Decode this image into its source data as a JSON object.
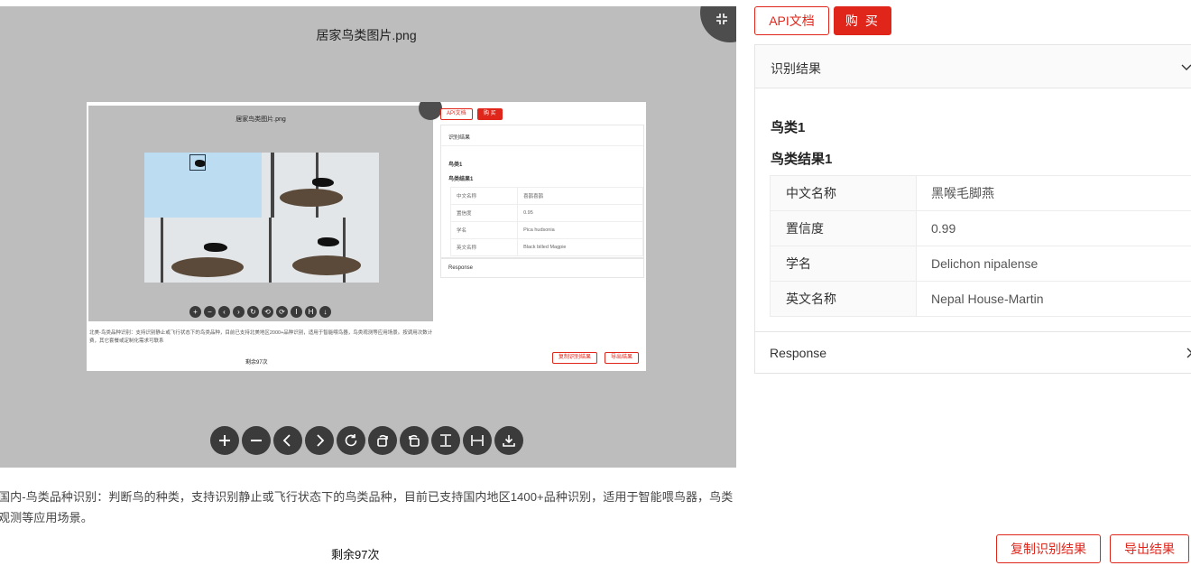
{
  "viewer": {
    "title": "居家鸟类图片.png",
    "toolbar": [
      "zoom-in",
      "zoom-out",
      "previous",
      "next",
      "reset",
      "rotate-left",
      "rotate-right",
      "fit-height",
      "fit-width",
      "download"
    ]
  },
  "embedded_screenshot": {
    "title": "居家鸟类图片.png",
    "api_label": "API文档",
    "buy_label": "购 买",
    "panel_header": "识别结果",
    "bird_title": "鸟类1",
    "result_title": "鸟类结果1",
    "rows": [
      {
        "key": "中文名称",
        "value": "喜鹊喜鹊"
      },
      {
        "key": "置信度",
        "value": "0.95"
      },
      {
        "key": "学名",
        "value": "Pica hudsonia"
      },
      {
        "key": "英文名称",
        "value": "Black billed Magpie"
      }
    ],
    "response_label": "Response",
    "description": "北美-鸟类品种识别：支持识别静止或飞行状态下的鸟类品种，目前已支持北美地区2000+品种识别，适用于智能喂鸟器，鸟类观测等应用场景。按调用次数计费，其它套餐或定制化需求可联系",
    "remaining": "剩余97次",
    "copy_label": "复制识别结果",
    "export_label": "导出结果"
  },
  "description": "国内-鸟类品种识别：判断鸟的种类，支持识别静止或飞行状态下的鸟类品种，目前已支持国内地区1400+品种识别，适用于智能喂鸟器，鸟类观测等应用场景。",
  "remaining": "剩余97次",
  "header": {
    "api_label": "API文档",
    "buy_label": "购 买"
  },
  "result": {
    "panel_header": "识别结果",
    "bird_title": "鸟类1",
    "result_title": "鸟类结果1",
    "rows": [
      {
        "key": "中文名称",
        "value": "黑喉毛脚燕"
      },
      {
        "key": "置信度",
        "value": "0.99"
      },
      {
        "key": "学名",
        "value": "Delichon nipalense"
      },
      {
        "key": "英文名称",
        "value": "Nepal House-Martin"
      }
    ],
    "response_label": "Response"
  },
  "actions": {
    "copy_label": "复制识别结果",
    "export_label": "导出结果"
  },
  "colors": {
    "accent": "#e0261b",
    "viewer_bg": "#bdbdbd",
    "tool_bg": "#3b3b3b"
  }
}
